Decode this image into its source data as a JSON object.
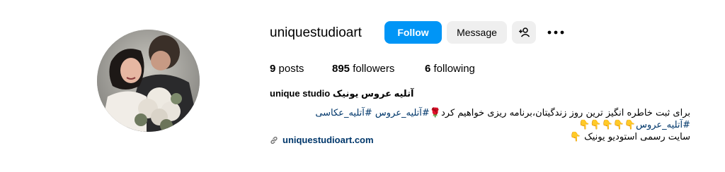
{
  "profile": {
    "username": "uniquestudioart",
    "full_name": "unique studio آتلیه عروس یونیک",
    "website": "uniquestudioart.com"
  },
  "actions": {
    "follow_label": "Follow",
    "message_label": "Message",
    "suggest_icon": "add-person-icon",
    "more_icon": "more-options-icon"
  },
  "stats": {
    "posts_count": "9",
    "posts_label": "posts",
    "followers_count": "895",
    "followers_label": "followers",
    "following_count": "6",
    "following_label": "following"
  },
  "bio": {
    "line1_text": "برای ثبت خاطره انگیز ترین روز زندگیتان،برنامه ریزی خواهیم کرد",
    "line1_rose": "🌹",
    "hashtags": [
      "#آتلیه_عروس",
      "#آتلیه_عکاسی",
      "#آتلیه_عروس"
    ],
    "line1_pointers": "👇👇👇👇👇",
    "line2_pointer": "👇",
    "line2_text": "سایت رسمی استودیو یونیک"
  },
  "colors": {
    "primary_button": "#0095f6",
    "secondary_button": "#efefef",
    "link": "#00376b"
  }
}
